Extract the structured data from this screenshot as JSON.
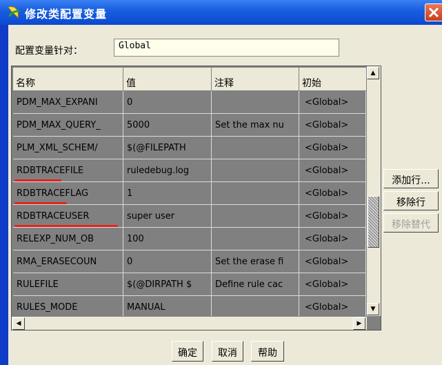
{
  "window": {
    "title": "修改类配置变量"
  },
  "config": {
    "label": "配置变量针对：",
    "value": "Global"
  },
  "table": {
    "headers": [
      "名称",
      "值",
      "注释",
      "初始"
    ],
    "rows": [
      {
        "name": "PDM_MAX_EXPANI",
        "value": "0",
        "comment": "",
        "initial": "<Global>"
      },
      {
        "name": "PDM_MAX_QUERY_",
        "value": "5000",
        "comment": "Set the max nu",
        "initial": "<Global>"
      },
      {
        "name": "PLM_XML_SCHEM/",
        "value": "$(@FILEPATH",
        "comment": "",
        "initial": "<Global>"
      },
      {
        "name": "RDBTRACEFILE",
        "value": "ruledebug.log",
        "comment": "",
        "initial": "<Global>"
      },
      {
        "name": "RDBTRACEFLAG",
        "value": "1",
        "comment": "",
        "initial": "<Global>"
      },
      {
        "name": "RDBTRACEUSER",
        "value": "super user",
        "comment": "",
        "initial": "<Global>"
      },
      {
        "name": "RELEXP_NUM_OB",
        "value": "100",
        "comment": "",
        "initial": "<Global>"
      },
      {
        "name": "RMA_ERASECOUN",
        "value": "0",
        "comment": "Set the erase fi",
        "initial": "<Global>"
      },
      {
        "name": "RULEFILE",
        "value": "$(@DIRPATH $",
        "comment": "Define rule cac",
        "initial": "<Global>"
      },
      {
        "name": "RULES_MODE",
        "value": "MANUAL",
        "comment": "",
        "initial": "<Global>"
      }
    ]
  },
  "side_buttons": {
    "add_row": "添加行...",
    "remove_row": "移除行",
    "remove_override": "移除替代"
  },
  "bottom_buttons": {
    "ok": "确定",
    "cancel": "取消",
    "help": "帮助"
  },
  "colors": {
    "title_bar": "#0b49cf",
    "client_bg": "#ece9d8",
    "table_bg": "#808080",
    "highlight": "#e52020",
    "disabled_text": "#a0a0a0"
  },
  "icons": {
    "app": "moon-leaf-icon",
    "close": "close-icon",
    "up": "arrow-up-icon",
    "down": "arrow-down-icon",
    "left": "arrow-left-icon",
    "right": "arrow-right-icon"
  }
}
